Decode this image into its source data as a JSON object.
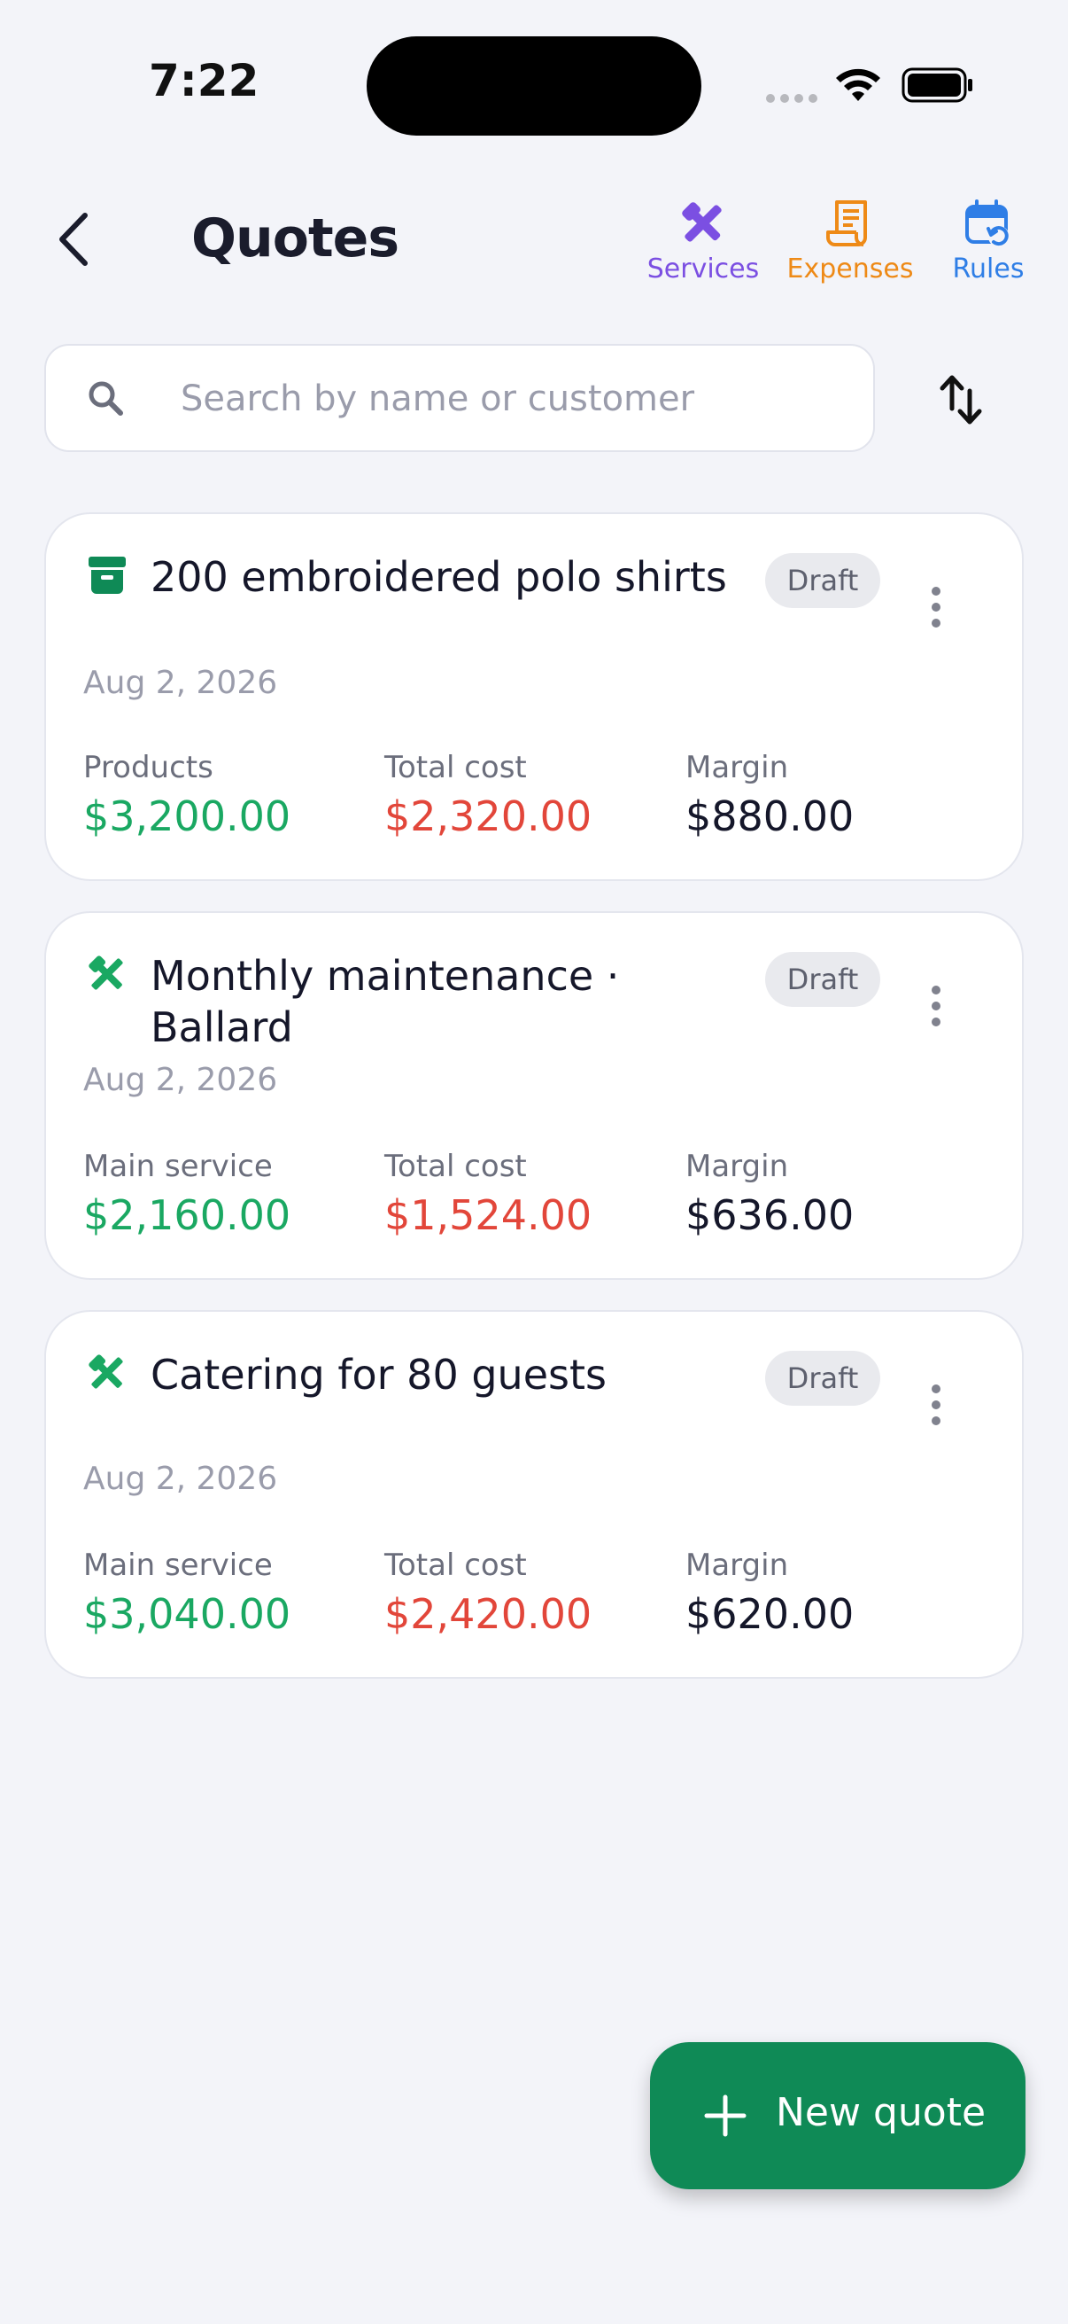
{
  "status_bar": {
    "time": "7:22"
  },
  "header": {
    "title": "Quotes",
    "actions": [
      {
        "label": "Services",
        "icon": "services-tools-icon",
        "color": "#7b4fe2"
      },
      {
        "label": "Expenses",
        "icon": "receipt-icon",
        "color": "#ee8a17"
      },
      {
        "label": "Rules",
        "icon": "calendar-refresh-icon",
        "color": "#2f7ee6"
      }
    ]
  },
  "search": {
    "placeholder": "Search by name or customer",
    "value": ""
  },
  "quotes": [
    {
      "title": "200 embroidered polo shirts",
      "icon": "archive-box-icon",
      "status": "Draft",
      "date": "Aug 2, 2026",
      "metrics": [
        {
          "label": "Products",
          "value": "$3,200.00",
          "color": "#1aa862"
        },
        {
          "label": "Total cost",
          "value": "$2,320.00",
          "color": "#e2463a"
        },
        {
          "label": "Margin",
          "value": "$880.00",
          "color": "#15172a"
        }
      ]
    },
    {
      "title": "Monthly maintenance · Ballard",
      "icon": "tools-icon",
      "status": "Draft",
      "date": "Aug 2, 2026",
      "metrics": [
        {
          "label": "Main service",
          "value": "$2,160.00",
          "color": "#1aa862"
        },
        {
          "label": "Total cost",
          "value": "$1,524.00",
          "color": "#e2463a"
        },
        {
          "label": "Margin",
          "value": "$636.00",
          "color": "#15172a"
        }
      ]
    },
    {
      "title": "Catering for 80 guests",
      "icon": "tools-icon",
      "status": "Draft",
      "date": "Aug 2, 2026",
      "metrics": [
        {
          "label": "Main service",
          "value": "$3,040.00",
          "color": "#1aa862"
        },
        {
          "label": "Total cost",
          "value": "$2,420.00",
          "color": "#e2463a"
        },
        {
          "label": "Margin",
          "value": "$620.00",
          "color": "#15172a"
        }
      ]
    }
  ],
  "fab": {
    "label": "New quote",
    "color": "#0f8a56"
  }
}
